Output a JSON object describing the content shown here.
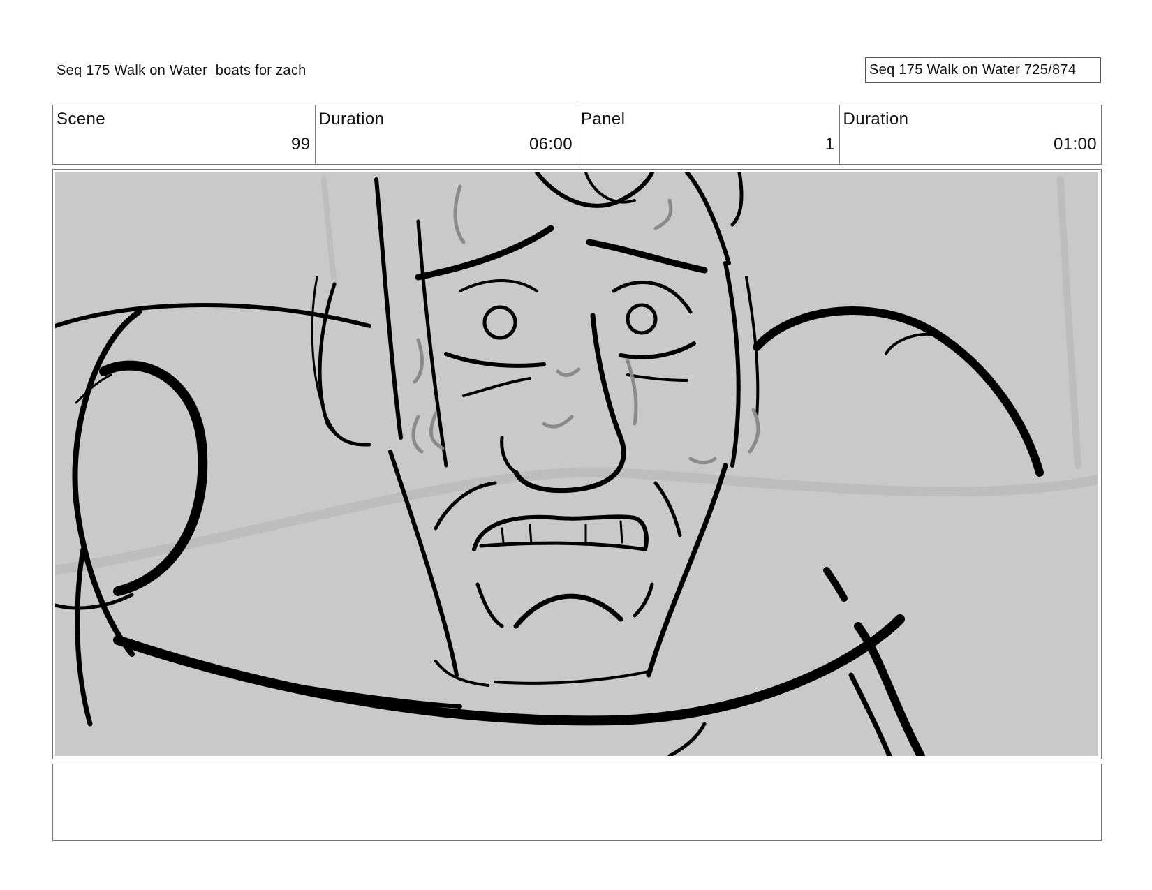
{
  "header": {
    "title": "Seq 175 Walk on Water  boats for zach",
    "page_counter": "Seq 175 Walk on Water 725/874"
  },
  "info": {
    "scene_label": "Scene",
    "scene_value": "99",
    "scene_duration_label": "Duration",
    "scene_duration_value": "06:00",
    "panel_label": "Panel",
    "panel_value": "1",
    "panel_duration_label": "Duration",
    "panel_duration_value": "01:00"
  },
  "panel": {
    "background_color": "#c9c9c9",
    "line_color": "#000000",
    "shading_color": "#8a8a8a",
    "illustration": "sketch-drawing"
  },
  "notes": {
    "text": ""
  }
}
